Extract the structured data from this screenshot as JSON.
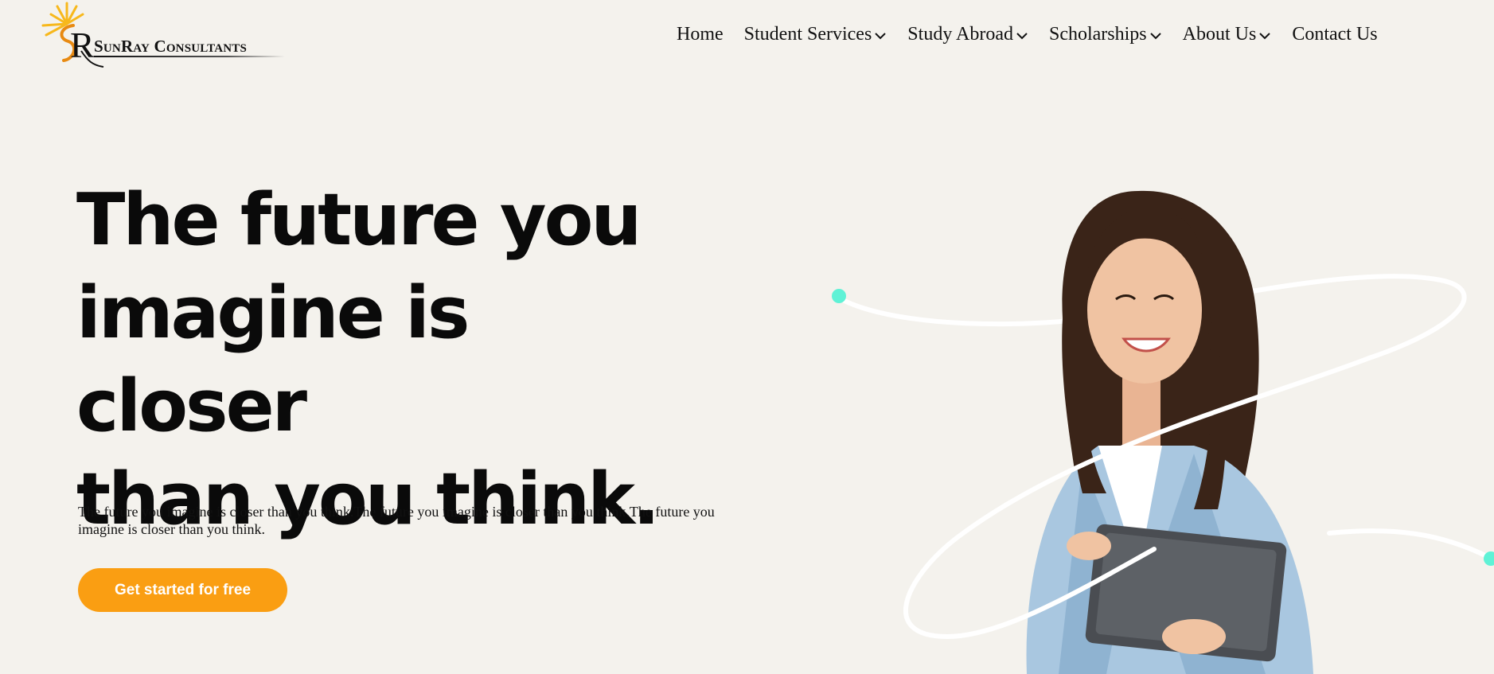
{
  "brand": {
    "name": "SunRay Consultants",
    "monogram": "R"
  },
  "nav": {
    "items": [
      {
        "label": "Home",
        "has_dropdown": false
      },
      {
        "label": "Student Services",
        "has_dropdown": true
      },
      {
        "label": "Study Abroad",
        "has_dropdown": true
      },
      {
        "label": "Scholarships",
        "has_dropdown": true
      },
      {
        "label": "About Us",
        "has_dropdown": true
      },
      {
        "label": "Contact Us",
        "has_dropdown": false
      }
    ]
  },
  "hero": {
    "title_lines": [
      "The future you",
      "imagine is closer",
      "than you think."
    ],
    "subtitle": "The future you imagine is closer than you think.The future you imagine is closer than you think.The future you imagine is closer than you think.",
    "cta_label": "Get started for free",
    "image_icon": "smiling-woman-with-tablet-photo"
  },
  "colors": {
    "background": "#f4f2ed",
    "accent": "#fa9e12",
    "teal_dot": "#5ff2d6",
    "logo_sun": "#f7b81c"
  }
}
